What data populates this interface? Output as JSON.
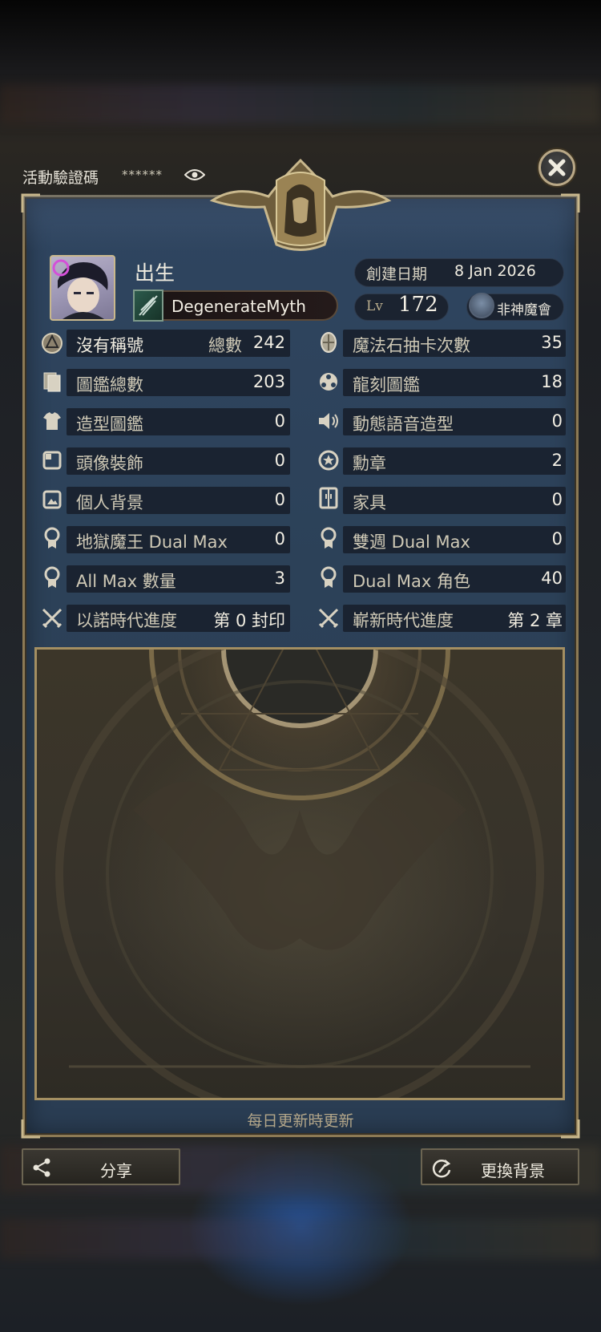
{
  "top_bar": {
    "event_code_label": "活動驗證碼",
    "event_code_masked": "******"
  },
  "profile": {
    "title": "出生",
    "name": "DegenerateMyth",
    "created_label": "創建日期",
    "created_date": "8 Jan 2026",
    "level_label": "Lv",
    "level": "172",
    "guild": "非神魔會"
  },
  "stats": {
    "left": [
      {
        "label": "沒有稱號",
        "sublabel": "總數",
        "value": "242",
        "icon": "title-medal-icon"
      },
      {
        "label": "圖鑑總數",
        "value": "203",
        "icon": "cards-icon"
      },
      {
        "label": "造型圖鑑",
        "value": "0",
        "icon": "shirt-icon"
      },
      {
        "label": "頭像裝飾",
        "value": "0",
        "icon": "frame-icon"
      },
      {
        "label": "個人背景",
        "value": "0",
        "icon": "picture-icon"
      },
      {
        "label": "地獄魔王 Dual Max",
        "value": "0",
        "icon": "ribbon-icon"
      },
      {
        "label": "All Max 數量",
        "value": "3",
        "icon": "ribbon-icon"
      },
      {
        "label": "以諾時代進度",
        "value": "第 0 封印",
        "icon": "crossed-swords-icon"
      }
    ],
    "right": [
      {
        "label": "魔法石抽卡次數",
        "value": "35",
        "icon": "stone-icon"
      },
      {
        "label": "龍刻圖鑑",
        "value": "18",
        "icon": "dragon-icon"
      },
      {
        "label": "動態語音造型",
        "value": "0",
        "icon": "speaker-icon"
      },
      {
        "label": "勳章",
        "value": "2",
        "icon": "star-badge-icon"
      },
      {
        "label": "家具",
        "value": "0",
        "icon": "cabinet-icon"
      },
      {
        "label": "雙週 Dual Max",
        "value": "0",
        "icon": "ribbon-icon"
      },
      {
        "label": "Dual Max 角色",
        "value": "40",
        "icon": "ribbon-icon"
      },
      {
        "label": "嶄新時代進度",
        "value": "第 2 章",
        "icon": "crossed-swords-icon"
      }
    ]
  },
  "footer_note": "每日更新時更新",
  "buttons": {
    "share": "分享",
    "change_background": "更換背景"
  },
  "colors": {
    "panel": "#2c4158",
    "row": "#1a2331",
    "gold": "#a48f62",
    "text": "#cfc9b6"
  }
}
